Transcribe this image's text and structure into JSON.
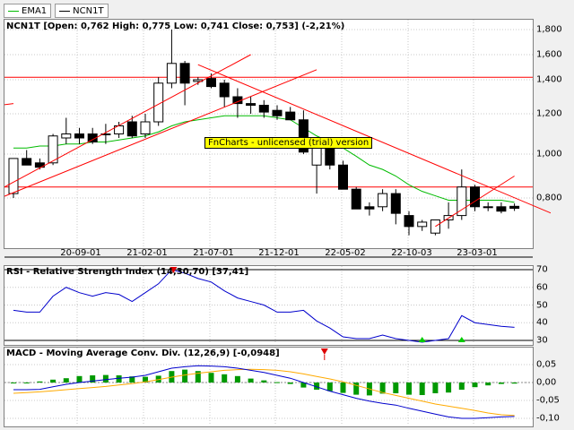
{
  "legend": [
    {
      "label": "EMA1",
      "color": "#00bb00"
    },
    {
      "label": "NCN1T",
      "color": "#000000"
    }
  ],
  "price_panel": {
    "title": "NCN1T [Open: 0,762  High: 0,775  Low: 0,741  Close: 0,753] (-2,21%)",
    "y_ticks": [
      "1,800",
      "1,600",
      "1,400",
      "1,200",
      "1,000",
      "0,800"
    ],
    "watermark": "FnCharts - unlicensed (trial) version"
  },
  "x_labels": [
    "20-09-01",
    "21-02-01",
    "21-07-01",
    "21-12-01",
    "22-05-02",
    "22-10-03",
    "23-03-01"
  ],
  "rsi_panel": {
    "title": "RSI - Relative Strength Index (14,30,70) [37,41]",
    "y_ticks": [
      "70",
      "60",
      "50",
      "40",
      "30"
    ]
  },
  "macd_panel": {
    "title": "MACD - Moving Average Conv. Div. (12,26,9) [-0,0948]",
    "y_ticks": [
      "0,05",
      "0,00",
      "-0,05",
      "-0,10"
    ]
  },
  "colors": {
    "ema": "#00bb00",
    "trend": "#ff0000",
    "rsi": "#0000cc",
    "signal": "#ffaa00",
    "hist": "#009900",
    "macd": "#0000cc"
  },
  "chart_data": [
    {
      "type": "candlestick",
      "series_name": "NCN1T",
      "ylim": [
        0.63,
        1.83
      ],
      "candles": [
        {
          "o": 0.82,
          "h": 0.98,
          "l": 0.8,
          "c": 0.98
        },
        {
          "o": 0.98,
          "h": 1.02,
          "l": 0.95,
          "c": 0.95
        },
        {
          "o": 0.96,
          "h": 0.98,
          "l": 0.93,
          "c": 0.94
        },
        {
          "o": 0.96,
          "h": 1.1,
          "l": 0.95,
          "c": 1.09
        },
        {
          "o": 1.08,
          "h": 1.18,
          "l": 1.05,
          "c": 1.1
        },
        {
          "o": 1.1,
          "h": 1.13,
          "l": 1.05,
          "c": 1.08
        },
        {
          "o": 1.1,
          "h": 1.13,
          "l": 1.05,
          "c": 1.06
        },
        {
          "o": 1.1,
          "h": 1.15,
          "l": 1.05,
          "c": 1.1
        },
        {
          "o": 1.1,
          "h": 1.16,
          "l": 1.08,
          "c": 1.14
        },
        {
          "o": 1.16,
          "h": 1.19,
          "l": 1.08,
          "c": 1.09
        },
        {
          "o": 1.1,
          "h": 1.2,
          "l": 1.08,
          "c": 1.16
        },
        {
          "o": 1.16,
          "h": 1.42,
          "l": 1.14,
          "c": 1.38
        },
        {
          "o": 1.38,
          "h": 1.8,
          "l": 1.35,
          "c": 1.53
        },
        {
          "o": 1.53,
          "h": 1.55,
          "l": 1.25,
          "c": 1.38
        },
        {
          "o": 1.39,
          "h": 1.42,
          "l": 1.37,
          "c": 1.4
        },
        {
          "o": 1.41,
          "h": 1.45,
          "l": 1.35,
          "c": 1.36
        },
        {
          "o": 1.38,
          "h": 1.4,
          "l": 1.24,
          "c": 1.3
        },
        {
          "o": 1.3,
          "h": 1.35,
          "l": 1.18,
          "c": 1.26
        },
        {
          "o": 1.26,
          "h": 1.3,
          "l": 1.2,
          "c": 1.25
        },
        {
          "o": 1.25,
          "h": 1.28,
          "l": 1.18,
          "c": 1.21
        },
        {
          "o": 1.22,
          "h": 1.25,
          "l": 1.17,
          "c": 1.19
        },
        {
          "o": 1.21,
          "h": 1.24,
          "l": 1.17,
          "c": 1.17
        },
        {
          "o": 1.17,
          "h": 1.22,
          "l": 1.0,
          "c": 1.01
        },
        {
          "o": 0.95,
          "h": 1.04,
          "l": 0.82,
          "c": 1.05
        },
        {
          "o": 1.05,
          "h": 1.08,
          "l": 0.93,
          "c": 0.95
        },
        {
          "o": 0.95,
          "h": 0.97,
          "l": 0.85,
          "c": 0.84
        },
        {
          "o": 0.84,
          "h": 0.85,
          "l": 0.75,
          "c": 0.75
        },
        {
          "o": 0.76,
          "h": 0.78,
          "l": 0.72,
          "c": 0.75
        },
        {
          "o": 0.76,
          "h": 0.84,
          "l": 0.74,
          "c": 0.82
        },
        {
          "o": 0.82,
          "h": 0.84,
          "l": 0.68,
          "c": 0.73
        },
        {
          "o": 0.72,
          "h": 0.74,
          "l": 0.63,
          "c": 0.67
        },
        {
          "o": 0.67,
          "h": 0.7,
          "l": 0.65,
          "c": 0.69
        },
        {
          "o": 0.64,
          "h": 0.7,
          "l": 0.63,
          "c": 0.7
        },
        {
          "o": 0.7,
          "h": 0.78,
          "l": 0.66,
          "c": 0.72
        },
        {
          "o": 0.72,
          "h": 0.93,
          "l": 0.7,
          "c": 0.85
        },
        {
          "o": 0.85,
          "h": 0.86,
          "l": 0.74,
          "c": 0.76
        },
        {
          "o": 0.76,
          "h": 0.78,
          "l": 0.74,
          "c": 0.76
        },
        {
          "o": 0.76,
          "h": 0.78,
          "l": 0.73,
          "c": 0.74
        },
        {
          "o": 0.762,
          "h": 0.775,
          "l": 0.741,
          "c": 0.753
        }
      ],
      "ema": [
        1.03,
        1.03,
        1.04,
        1.04,
        1.05,
        1.05,
        1.06,
        1.06,
        1.07,
        1.08,
        1.09,
        1.11,
        1.14,
        1.16,
        1.17,
        1.18,
        1.19,
        1.19,
        1.19,
        1.19,
        1.18,
        1.17,
        1.13,
        1.09,
        1.06,
        1.03,
        0.99,
        0.95,
        0.93,
        0.9,
        0.86,
        0.83,
        0.81,
        0.79,
        0.79,
        0.79,
        0.79,
        0.79,
        0.78
      ],
      "horizontal_lines": [
        1.42,
        0.85
      ],
      "trend_lines": [
        {
          "from": [
            -1,
            0.84
          ],
          "to": [
            18,
            1.6
          ]
        },
        {
          "from": [
            -1,
            0.8
          ],
          "to": [
            23,
            1.48
          ]
        },
        {
          "from": [
            14,
            1.52
          ],
          "to": [
            42,
            0.7
          ]
        },
        {
          "from": [
            32,
            0.67
          ],
          "to": [
            38,
            0.9
          ]
        },
        {
          "from": [
            -1,
            1.25
          ],
          "to": [
            0,
            1.26
          ]
        }
      ]
    },
    {
      "type": "line",
      "series_name": "RSI",
      "ylim": [
        25,
        75
      ],
      "reference_lines": [
        70,
        30
      ],
      "values": [
        47,
        46,
        46,
        55,
        60,
        57,
        55,
        57,
        56,
        52,
        57,
        62,
        70,
        68,
        65,
        63,
        58,
        54,
        52,
        50,
        46,
        46,
        47,
        41,
        37,
        32,
        31,
        31,
        33,
        31,
        30,
        29,
        30,
        31,
        44,
        40,
        39,
        38,
        37.41
      ],
      "buy_markers": [
        31,
        34
      ],
      "sell_markers": [
        12
      ]
    },
    {
      "type": "bar",
      "series_name": "MACD",
      "ylim": [
        -0.115,
        0.075
      ],
      "histogram": [
        0.0,
        -0.002,
        0.003,
        0.008,
        0.012,
        0.018,
        0.02,
        0.021,
        0.02,
        0.017,
        0.016,
        0.019,
        0.032,
        0.036,
        0.032,
        0.027,
        0.023,
        0.018,
        0.011,
        0.006,
        0.001,
        -0.004,
        -0.014,
        -0.02,
        -0.024,
        -0.029,
        -0.034,
        -0.036,
        -0.031,
        -0.03,
        -0.034,
        -0.035,
        -0.03,
        -0.028,
        -0.02,
        -0.013,
        -0.008,
        -0.004,
        -0.003
      ],
      "macd_line": [
        -0.02,
        -0.02,
        -0.019,
        -0.012,
        -0.005,
        0.0,
        0.004,
        0.008,
        0.012,
        0.015,
        0.02,
        0.03,
        0.04,
        0.044,
        0.047,
        0.046,
        0.044,
        0.04,
        0.034,
        0.028,
        0.02,
        0.012,
        0.0,
        -0.012,
        -0.024,
        -0.034,
        -0.044,
        -0.052,
        -0.058,
        -0.063,
        -0.072,
        -0.08,
        -0.088,
        -0.096,
        -0.1,
        -0.1,
        -0.098,
        -0.096,
        -0.0948
      ],
      "signal_line": [
        -0.03,
        -0.028,
        -0.026,
        -0.023,
        -0.02,
        -0.017,
        -0.014,
        -0.011,
        -0.007,
        -0.003,
        0.002,
        0.008,
        0.015,
        0.021,
        0.026,
        0.03,
        0.034,
        0.036,
        0.037,
        0.036,
        0.034,
        0.03,
        0.024,
        0.017,
        0.01,
        0.002,
        -0.008,
        -0.018,
        -0.028,
        -0.036,
        -0.044,
        -0.052,
        -0.06,
        -0.066,
        -0.072,
        -0.078,
        -0.085,
        -0.09,
        -0.092
      ],
      "sell_markers": [
        24
      ]
    }
  ]
}
